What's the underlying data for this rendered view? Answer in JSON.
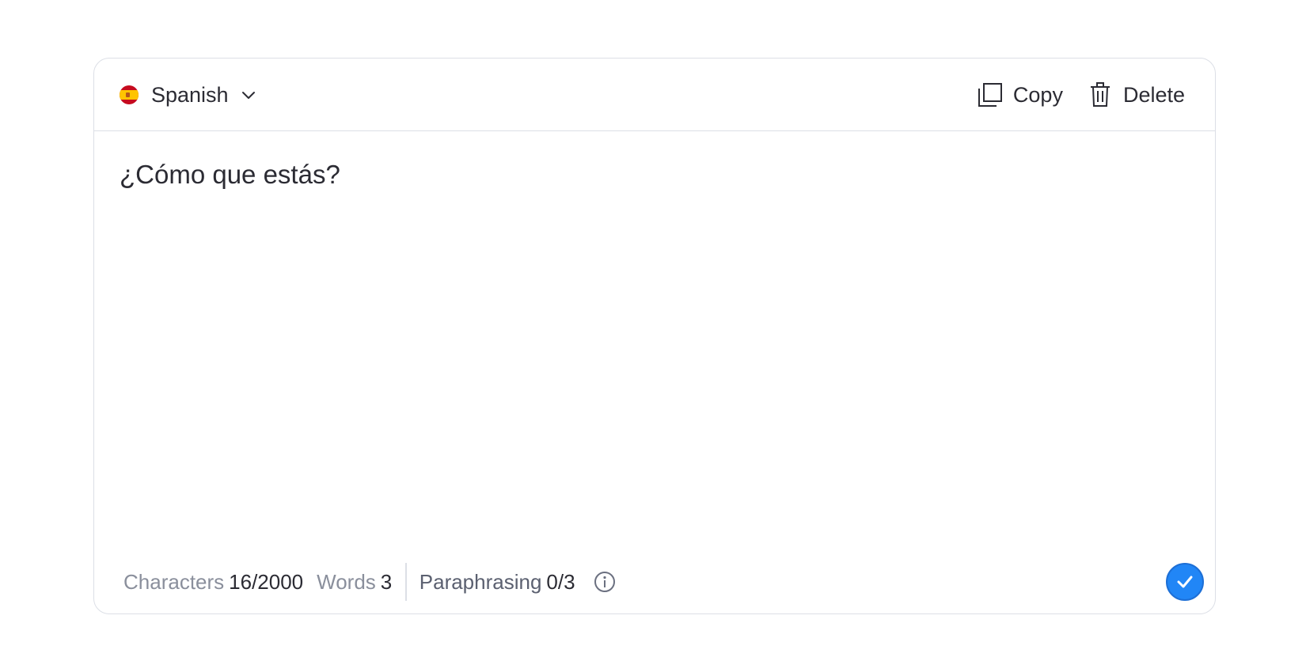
{
  "language_selector": {
    "flag_icon": "spain-flag-icon",
    "label": "Spanish",
    "chevron_icon": "chevron-down-icon"
  },
  "actions": {
    "copy_label": "Copy",
    "copy_icon": "copy-icon",
    "delete_label": "Delete",
    "delete_icon": "trash-icon"
  },
  "editor": {
    "text": "¿Cómo que estás?"
  },
  "footer": {
    "characters_label": "Characters",
    "characters_value": "16/2000",
    "words_label": "Words",
    "words_value": "3",
    "paraphrasing_label": "Paraphrasing",
    "paraphrasing_value": "0/3",
    "info_icon": "info-icon"
  },
  "confirm_button": {
    "icon": "checkmark-icon"
  },
  "colors": {
    "accent": "#2186f6",
    "border": "#dcdfe6",
    "text": "#2b2b33",
    "muted": "#8a8f9c"
  }
}
